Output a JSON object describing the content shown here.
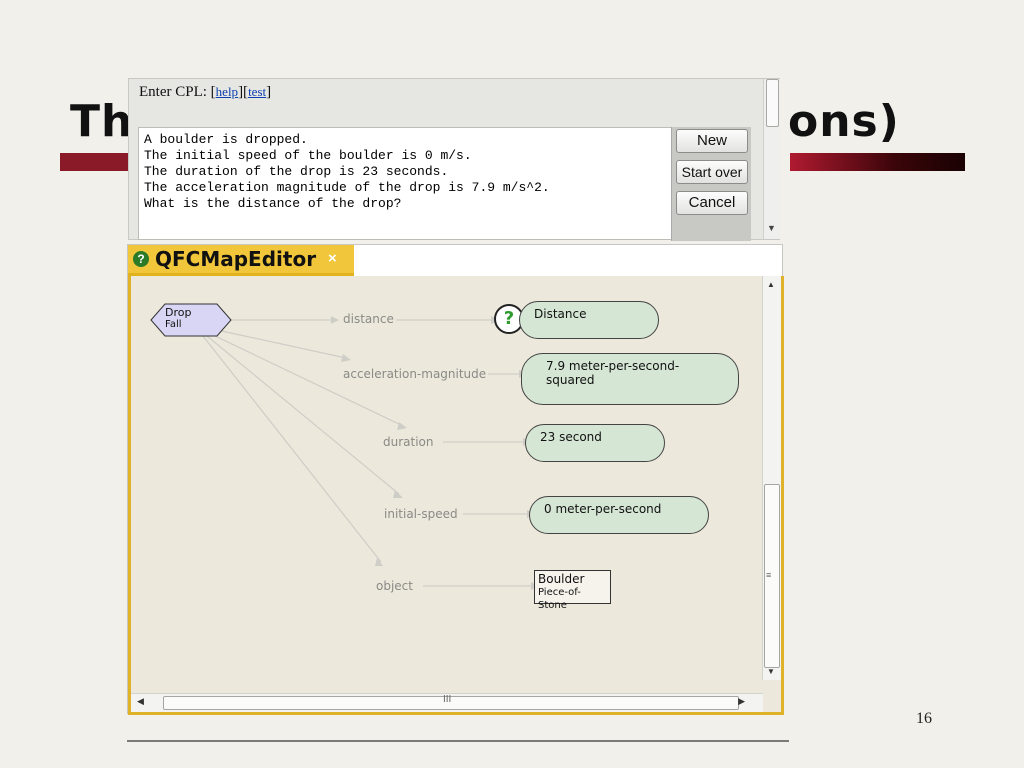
{
  "slide": {
    "title_head": "Th",
    "title_tail": "ons)",
    "page_number": "16",
    "accent_color": "#a3162a"
  },
  "cpl": {
    "label": "Enter CPL: ",
    "help_link": "help",
    "test_link": "test",
    "text": "A boulder is dropped.\nThe initial speed of the boulder is 0 m/s.\nThe duration of the drop is 23 seconds.\nThe acceleration magnitude of the drop is 7.9 m/s^2.\nWhat is the distance of the drop?",
    "buttons": {
      "new": "New",
      "start_over": "Start over",
      "cancel": "Cancel"
    }
  },
  "editor": {
    "tab_title": "QFCMapEditor",
    "tab_icon": "question-circle-icon",
    "tab_close": "×",
    "tab_color": "#f1c63a",
    "source_node": {
      "label": "Drop",
      "type": "Fall"
    },
    "relations": [
      {
        "name": "distance",
        "target": "Distance",
        "target_kind": "unknown"
      },
      {
        "name": "acceleration-magnitude",
        "target": "7.9 meter-per-second-squared",
        "target_kind": "value"
      },
      {
        "name": "duration",
        "target": "23 second",
        "target_kind": "value"
      },
      {
        "name": "initial-speed",
        "target": "0 meter-per-second",
        "target_kind": "value"
      },
      {
        "name": "object",
        "target": "Boulder",
        "target_type": "Piece-of-Stone",
        "target_kind": "entity"
      }
    ],
    "unknown_marker": "?",
    "scroll_grip_v": "≡",
    "scroll_grip_h": "III"
  }
}
